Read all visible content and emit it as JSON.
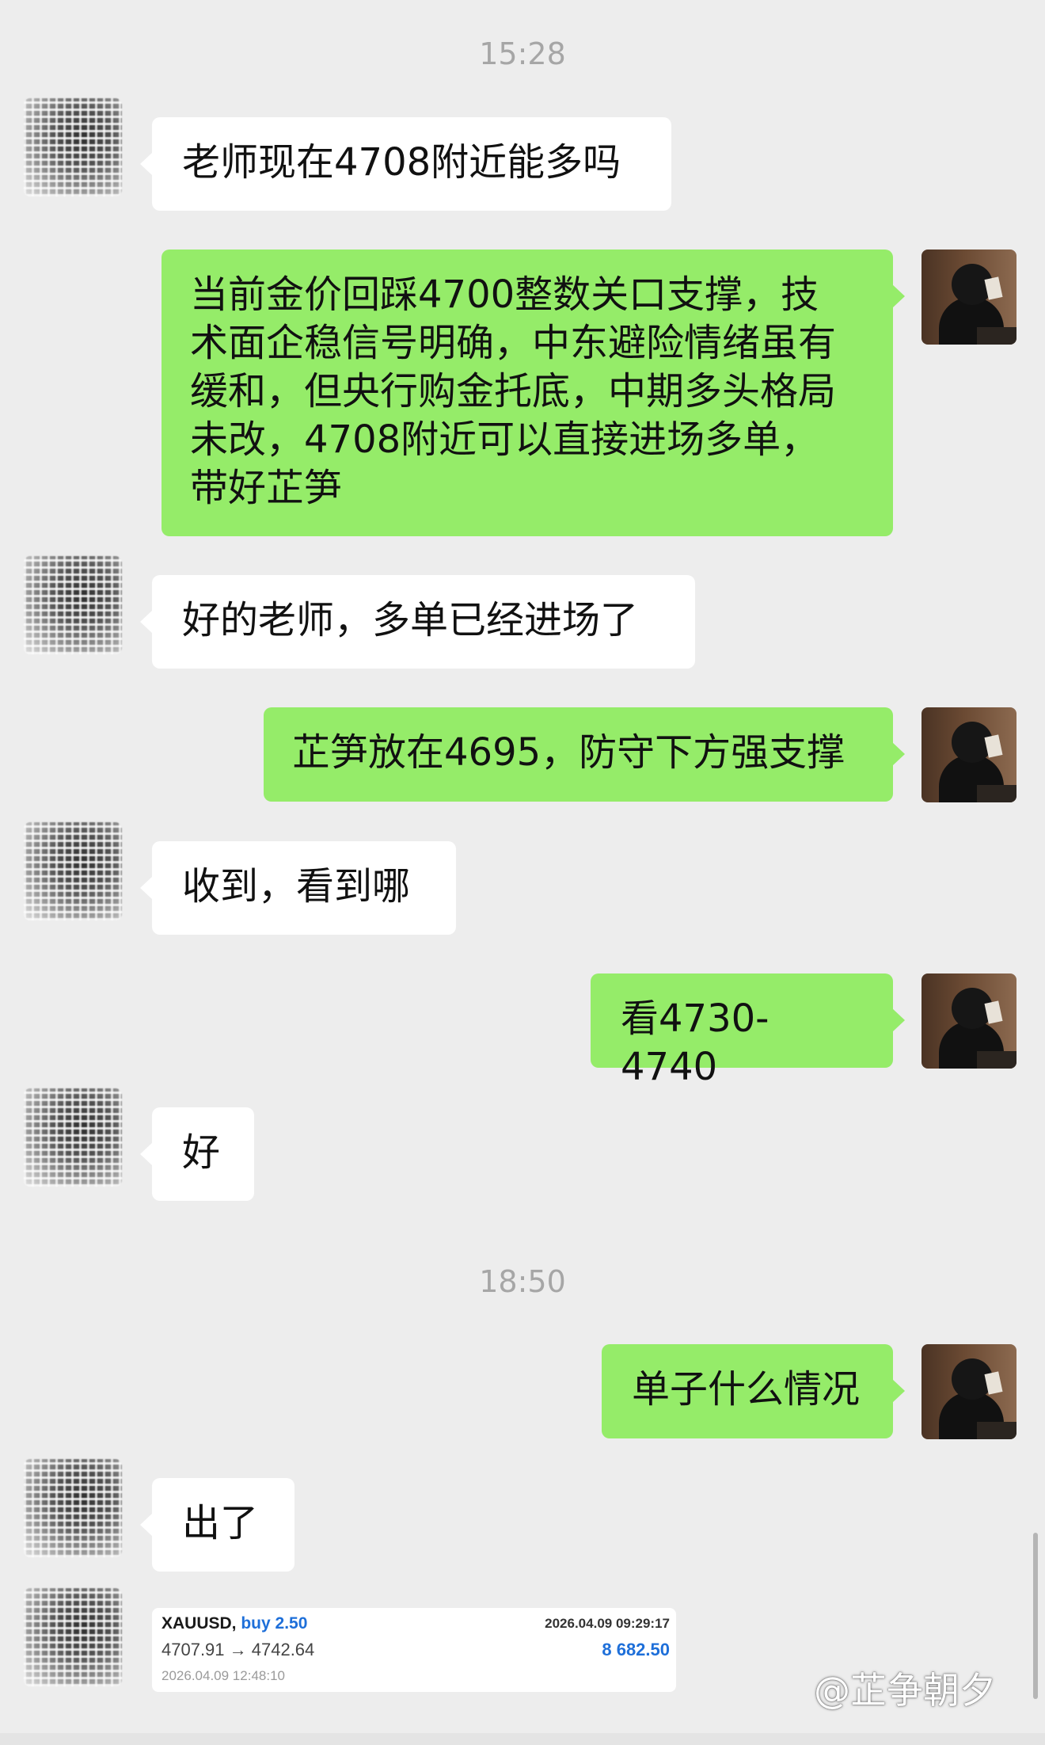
{
  "chat": {
    "timestamps": [
      "15:28",
      "18:50"
    ],
    "messages": [
      {
        "side": "left",
        "text": "老师现在4708附近能多吗"
      },
      {
        "side": "right",
        "text": "当前金价回踩4700整数关口支撑，技\n术面企稳信号明确，中东避险情绪虽有\n缓和，但央行购金托底，中期多头格局\n未改，4708附近可以直接进场多单，\n带好芷笋"
      },
      {
        "side": "left",
        "text": "好的老师，多单已经进场了"
      },
      {
        "side": "right",
        "text": "芷笋放在4695，防守下方强支撑"
      },
      {
        "side": "left",
        "text": "收到，看到哪"
      },
      {
        "side": "right",
        "text": "看4730-4740"
      },
      {
        "side": "left",
        "text": "好"
      },
      {
        "side": "right",
        "text": "单子什么情况"
      },
      {
        "side": "left",
        "text": "出了"
      }
    ],
    "trade_card": {
      "symbol": "XAUUSD,",
      "action": "buy 2.50",
      "open_time": "2026.04.09 09:29:17",
      "prices": "4707.91 → 4742.64",
      "profit": "8 682.50",
      "close_time": "2026.04.09 12:48:10"
    }
  },
  "watermark": "@芷争朝夕",
  "colors": {
    "background": "#ededed",
    "incoming_bubble": "#ffffff",
    "outgoing_bubble": "#95ec69",
    "timestamp": "#a6a6a6",
    "trade_accent": "#1e6fd9"
  }
}
